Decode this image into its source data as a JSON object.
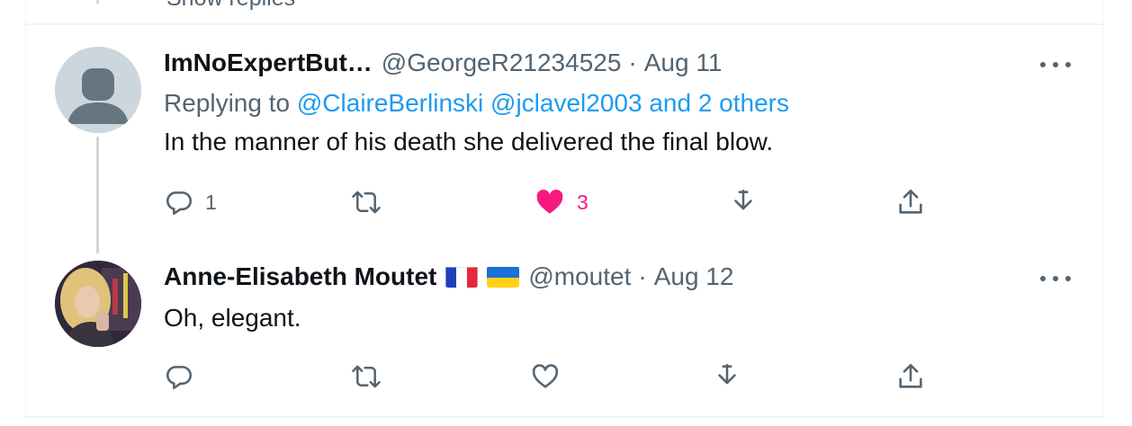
{
  "thread_above": {
    "remnant_text": "Show replies"
  },
  "tweets": [
    {
      "display_name": "ImNoExpertBut…",
      "handle": "@GeorgeR21234525",
      "separator": "·",
      "date": "Aug 11",
      "replying_to_label": "Replying to",
      "replying_to_users": "@ClaireBerlinski @jclavel2003",
      "replying_to_others": "and 2 others",
      "text": "In the manner of his death she delivered the final blow.",
      "reply_count": "1",
      "retweet_count": "",
      "like_count": "3",
      "liked": true,
      "avatar": "default-avatar-icon"
    },
    {
      "display_name": "Anne-Elisabeth Moutet",
      "flags": [
        "flag-france-icon",
        "flag-ukraine-icon"
      ],
      "handle": "@moutet",
      "separator": "·",
      "date": "Aug 12",
      "text": "Oh, elegant.",
      "reply_count": "",
      "retweet_count": "",
      "like_count": "",
      "liked": false,
      "avatar": "profile-photo"
    }
  ],
  "colors": {
    "link": "#1d9bf0",
    "secondary_text": "#536471",
    "like": "#f91880",
    "thread_line": "#cfd9de",
    "border": "#eff3f4"
  }
}
